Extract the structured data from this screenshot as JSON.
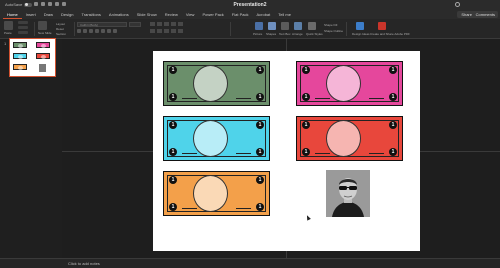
{
  "titlebar": {
    "autosave_label": "AutoSave",
    "autosave_state": "OFF",
    "title": "Presentation2"
  },
  "tabs": [
    "Home",
    "Insert",
    "Draw",
    "Design",
    "Transitions",
    "Animations",
    "Slide Show",
    "Review",
    "View",
    "Power Pack",
    "Flat Pack",
    "Acrobat",
    "Tell me"
  ],
  "active_tab": "Home",
  "actions": {
    "share": "Share",
    "comments": "Comments"
  },
  "ribbon": {
    "paste": "Paste",
    "new_slide": "New Slide",
    "layout": "Layout",
    "reset": "Reset",
    "section": "Section",
    "font_placeholder": "Calibri (Body)",
    "picture": "Picture",
    "shapes": "Shapes",
    "text_box": "Text Box",
    "arrange": "Arrange",
    "quick_styles": "Quick Styles",
    "shape_fill": "Shape Fill",
    "shape_outline": "Shape Outline",
    "design_ideas": "Design Ideas",
    "create_share": "Create and Share Adobe PDF"
  },
  "sidebar": {
    "slide_number": "1"
  },
  "slide": {
    "bills": [
      {
        "color": "#6b8f6b",
        "pos": "left-1"
      },
      {
        "color": "#4fd3ea",
        "pos": "left-2"
      },
      {
        "color": "#f3a04a",
        "pos": "left-3"
      },
      {
        "color": "#e5479c",
        "pos": "right-1"
      },
      {
        "color": "#e8473c",
        "pos": "right-2"
      }
    ],
    "bill_corner_value": "1"
  },
  "notes": {
    "placeholder": "Click to add notes"
  },
  "colors": {
    "accent": "#d35230",
    "green_bill": "#6b8f6b",
    "cyan_bill": "#4fd3ea",
    "orange_bill": "#f3a04a",
    "pink_bill": "#e5479c",
    "red_bill": "#e8473c"
  }
}
